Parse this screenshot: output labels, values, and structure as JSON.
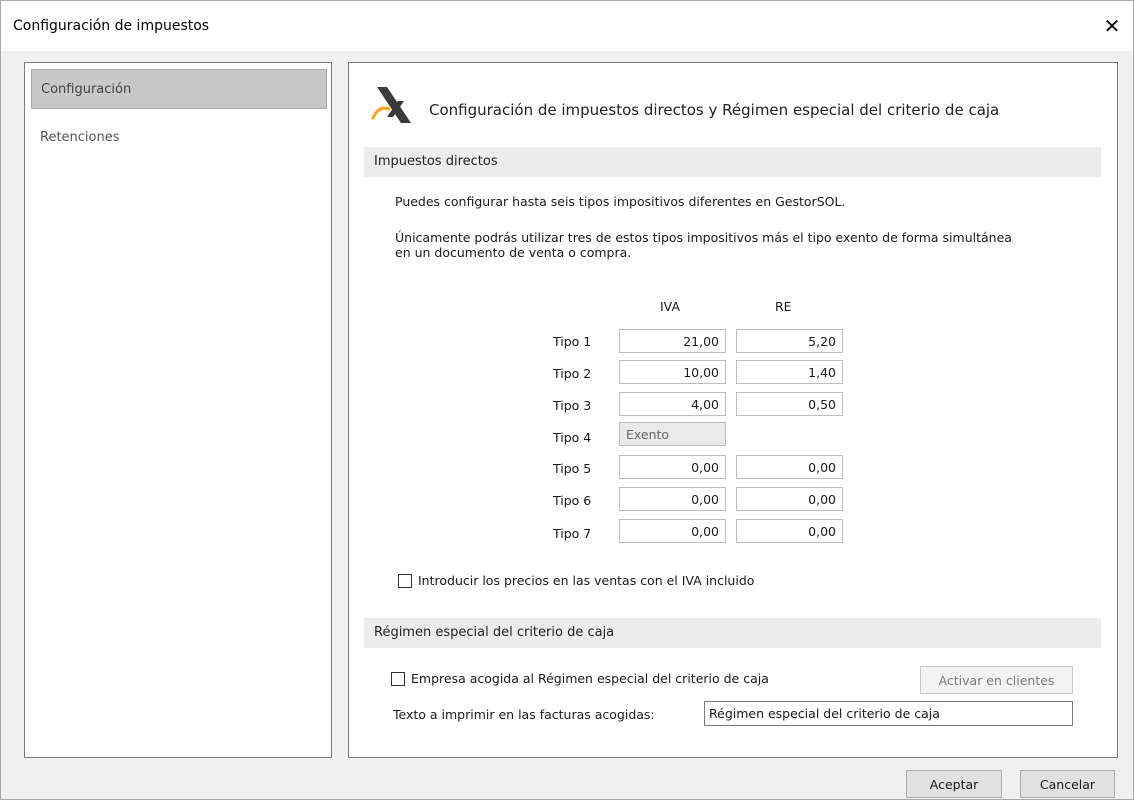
{
  "window": {
    "title": "Configuración de impuestos",
    "close_glyph": "✕"
  },
  "sidebar": {
    "items": [
      {
        "label": "Configuración",
        "active": true
      },
      {
        "label": "Retenciones",
        "active": false
      }
    ]
  },
  "header": {
    "icon": "tax-agency-logo-icon",
    "title": "Configuración de impuestos directos y Régimen especial del criterio de caja"
  },
  "direct_taxes": {
    "section_title": "Impuestos directos",
    "info_line_1": "Puedes configurar hasta seis tipos impositivos diferentes en GestorSOL.",
    "info_line_2a": "Únicamente podrás utilizar tres de estos tipos impositivos más el tipo exento de forma simultánea",
    "info_line_2b": "en un documento de venta o compra.",
    "col_iva": "IVA",
    "col_re": "RE",
    "rows": [
      {
        "label": "Tipo 1",
        "iva": "21,00",
        "re": "5,20"
      },
      {
        "label": "Tipo 2",
        "iva": "10,00",
        "re": "1,40"
      },
      {
        "label": "Tipo 3",
        "iva": "4,00",
        "re": "0,50"
      },
      {
        "label": "Tipo 4",
        "iva": "Exento",
        "re": ""
      },
      {
        "label": "Tipo 5",
        "iva": "0,00",
        "re": "0,00"
      },
      {
        "label": "Tipo 6",
        "iva": "0,00",
        "re": "0,00"
      },
      {
        "label": "Tipo 7",
        "iva": "0,00",
        "re": "0,00"
      }
    ],
    "include_vat_label": "Introducir los precios en las ventas con el IVA incluido",
    "include_vat_checked": false
  },
  "cash_regime": {
    "section_title": "Régimen especial del criterio de caja",
    "company_checkbox_label": "Empresa acogida al Régimen especial del criterio de caja",
    "company_checked": false,
    "activate_button": "Activar en clientes",
    "print_text_label": "Texto a imprimir en las facturas acogidas:",
    "print_text_value": "Régimen especial del criterio de caja"
  },
  "footer": {
    "accept_button": "Aceptar",
    "cancel_button": "Cancelar"
  }
}
